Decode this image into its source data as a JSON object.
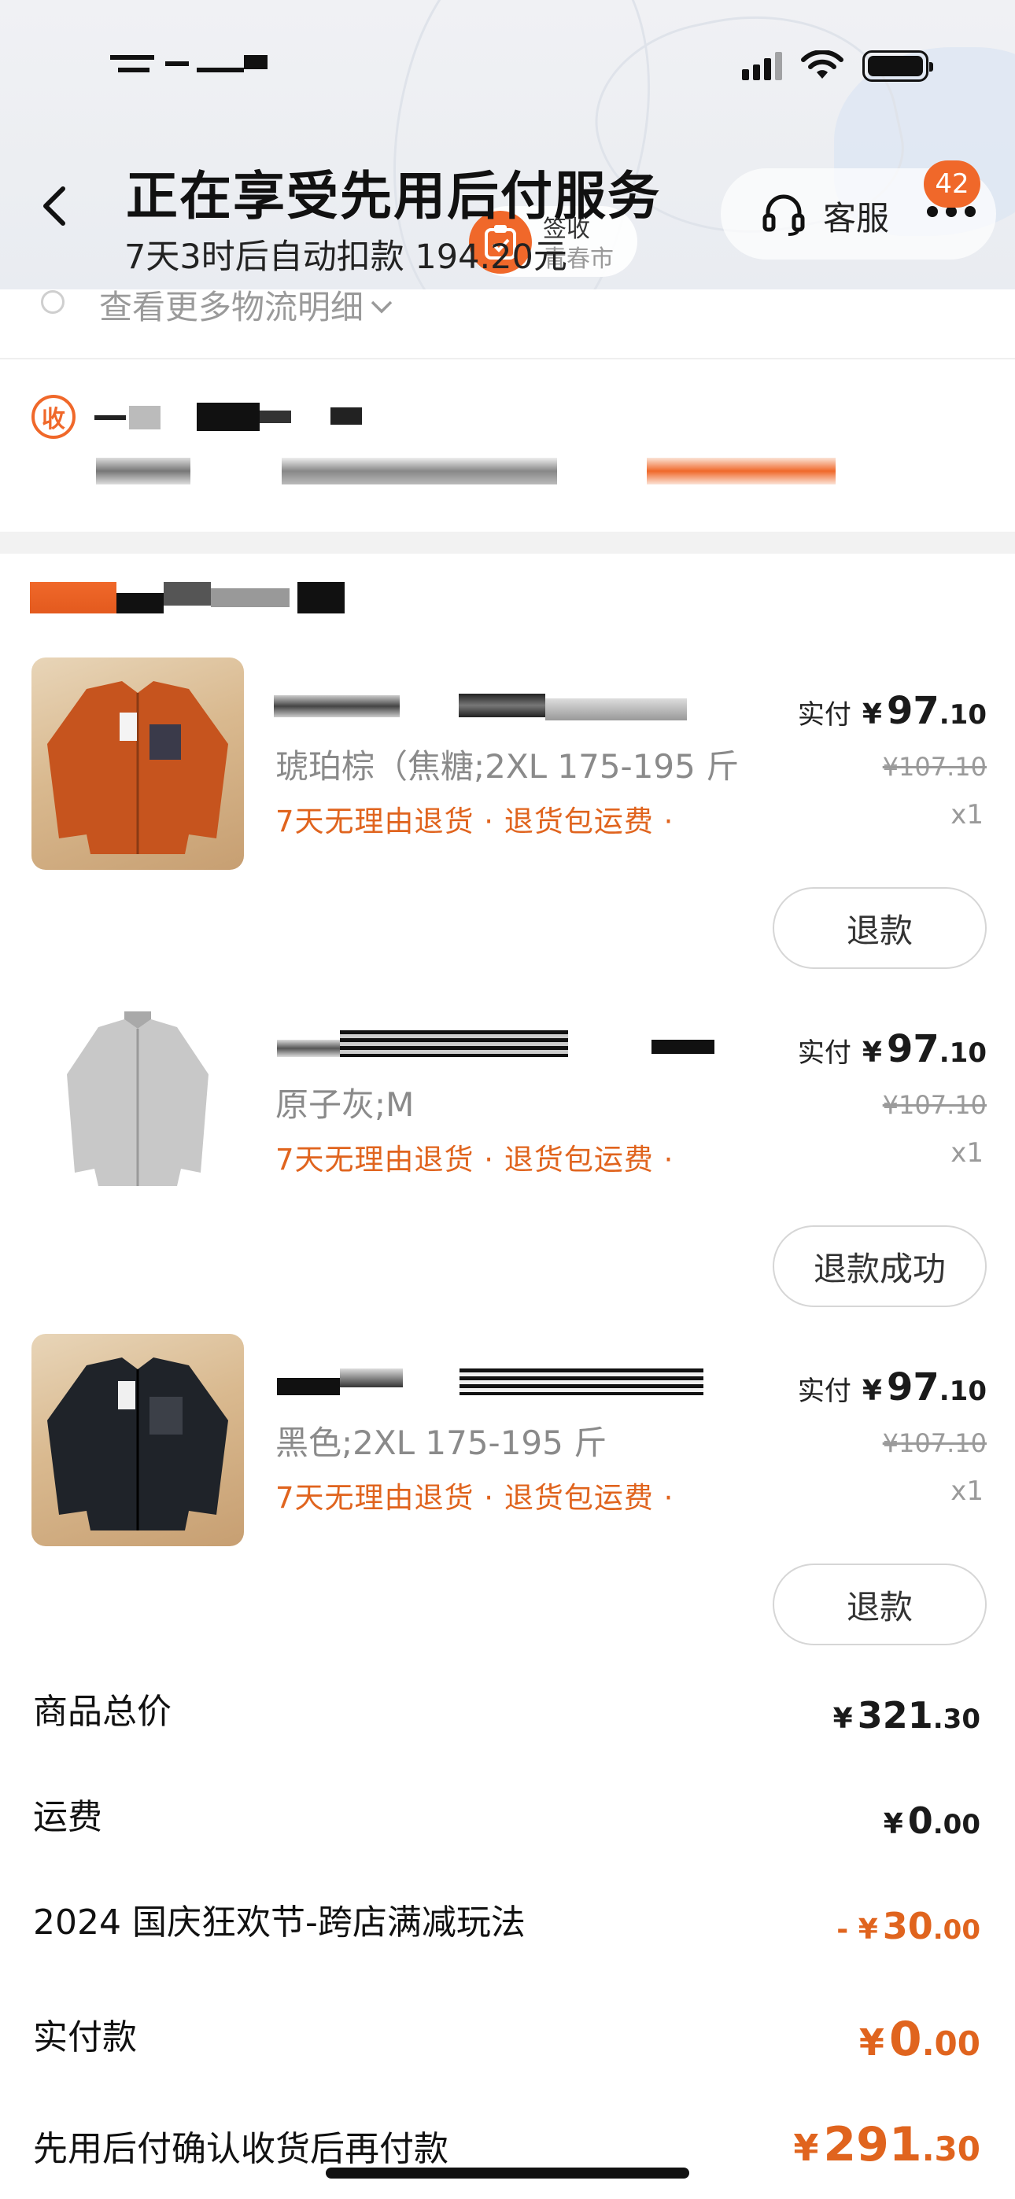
{
  "header": {
    "title": "正在享受先用后付服务",
    "subtitle": "7天3时后自动扣款 194.20元",
    "sign_chip": {
      "line1": "签收",
      "line2": "青春市"
    },
    "customer_service": "客服",
    "more_badge": "42",
    "accent_color": "#f0682a"
  },
  "logistics": {
    "more_details": "查看更多物流明细"
  },
  "address": {
    "tag": "收"
  },
  "items": [
    {
      "spec": "琥珀棕（焦糖;2XL 175-195 斤",
      "policy": "7天无理由退货 · 退货包运费 ·",
      "paid_label": "实付",
      "yen": "¥",
      "price_int": "97",
      "price_dec": ".10",
      "orig_price": "¥107.10",
      "qty": "x1",
      "button": "退款"
    },
    {
      "spec": "原子灰;M",
      "policy": "7天无理由退货 · 退货包运费 ·",
      "paid_label": "实付",
      "yen": "¥",
      "price_int": "97",
      "price_dec": ".10",
      "orig_price": "¥107.10",
      "qty": "x1",
      "button": "退款成功"
    },
    {
      "spec": "黑色;2XL 175-195 斤",
      "policy": "7天无理由退货 · 退货包运费 ·",
      "paid_label": "实付",
      "yen": "¥",
      "price_int": "97",
      "price_dec": ".10",
      "orig_price": "¥107.10",
      "qty": "x1",
      "button": "退款"
    }
  ],
  "summary": {
    "goods_total": {
      "label": "商品总价",
      "yen": "¥",
      "int": "321",
      "dec": ".30"
    },
    "shipping": {
      "label": "运费",
      "yen": "¥",
      "int": "0",
      "dec": ".00"
    },
    "discount": {
      "label": "2024 国庆狂欢节-跨店满减玩法",
      "yen": "- ¥",
      "int": "30",
      "dec": ".00"
    },
    "paid": {
      "label": "实付款",
      "yen": "¥",
      "int": "0",
      "dec": ".00"
    },
    "pay_later": {
      "label": "先用后付确认收货后再付款",
      "yen": "¥",
      "int": "291",
      "dec": ".30"
    }
  }
}
